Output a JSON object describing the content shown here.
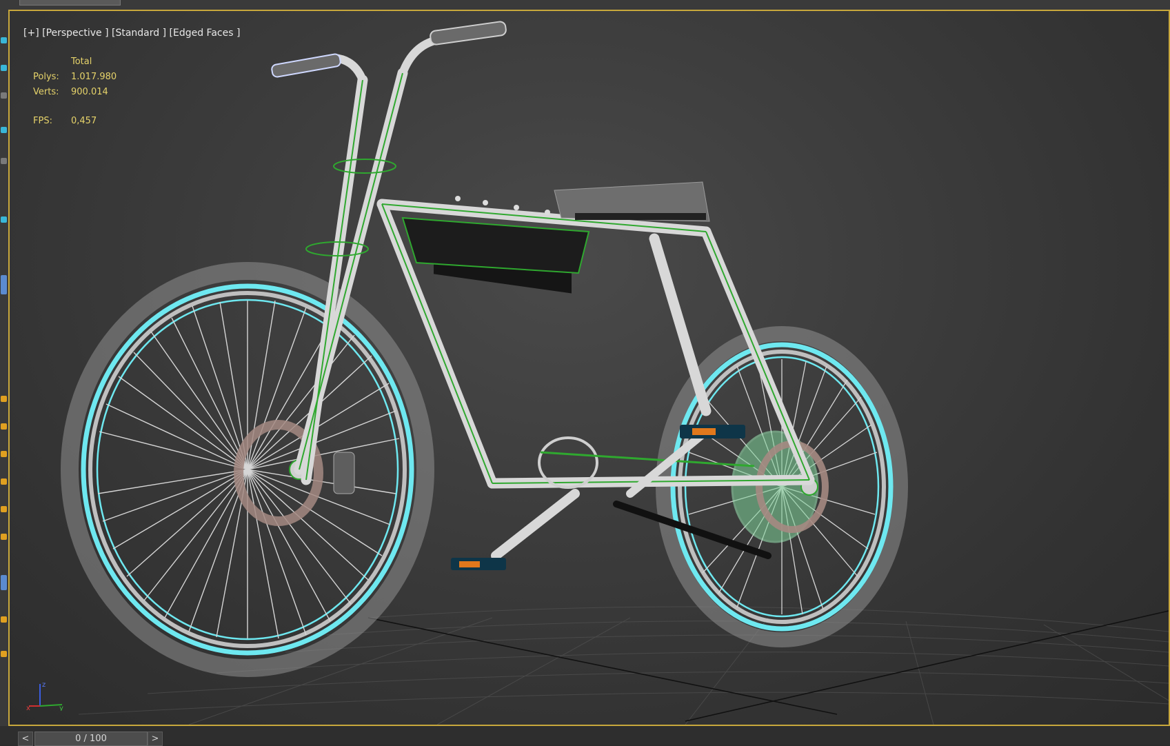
{
  "viewport": {
    "label": "[+] [Perspective ] [Standard ] [Edged Faces ]",
    "stats": {
      "total_label": "Total",
      "polys_label": "Polys:",
      "polys_value": "1.017.980",
      "verts_label": "Verts:",
      "verts_value": "900.014",
      "fps_label": "FPS:",
      "fps_value": "0,457"
    },
    "axis_tripod": {
      "z_label": "z",
      "x_label": "x",
      "y_label": "y"
    }
  },
  "timeline": {
    "prev_label": "<",
    "frame_display": "0 / 100",
    "next_label": ">"
  },
  "colors": {
    "viewport_border": "#c8a83c",
    "stats_text": "#e6d36a",
    "rim_highlight": "#6ee8f0",
    "selection_wire": "#2fa82f",
    "pedal_orange": "#e0781c"
  },
  "icons": [
    "axis-tripod-icon",
    "bicycle-model",
    "grid-floor"
  ]
}
